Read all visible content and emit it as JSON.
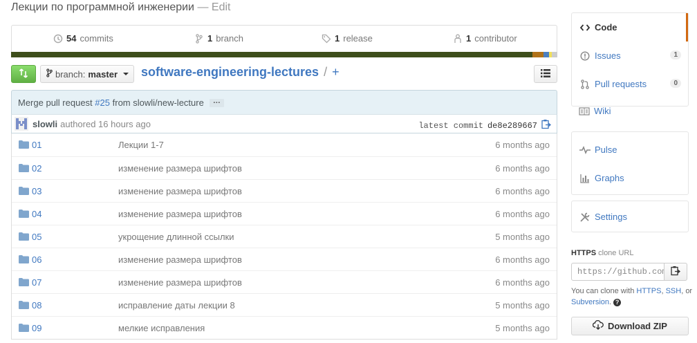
{
  "repo": {
    "description": "Лекции по программной инженерии",
    "edit_sep": "— ",
    "edit_label": "Edit",
    "name": "software-engineering-lectures",
    "path_sep": "/",
    "new_file": "+"
  },
  "summary": {
    "commits_count": "54",
    "commits_label": "commits",
    "branches_count": "1",
    "branches_label": "branch",
    "releases_count": "1",
    "releases_label": "release",
    "contributors_count": "1",
    "contributors_label": "contributor"
  },
  "language_bar": [
    {
      "share": 0.955,
      "color": "#3e4e1b"
    },
    {
      "share": 0.02,
      "color": "#b07219"
    },
    {
      "share": 0.01,
      "color": "#4c7fbf"
    },
    {
      "share": 0.005,
      "color": "#f1e05a"
    },
    {
      "share": 0.01,
      "color": "#ccc"
    }
  ],
  "toolbar": {
    "branch_prefix": "branch:",
    "branch_name": "master"
  },
  "commit": {
    "message_prefix": "Merge pull request",
    "pr_number": "#25",
    "message_suffix": "from slowli/new-lecture",
    "ellipsis": "…",
    "author": "slowli",
    "authored_text": "authored 16 hours ago",
    "latest_label": "latest commit",
    "sha": "de8e289667"
  },
  "files": [
    {
      "name": "01",
      "message": "Лекции 1-7",
      "age": "6 months ago"
    },
    {
      "name": "02",
      "message": "изменение размера шрифтов",
      "age": "6 months ago"
    },
    {
      "name": "03",
      "message": "изменение размера шрифтов",
      "age": "6 months ago"
    },
    {
      "name": "04",
      "message": "изменение размера шрифтов",
      "age": "6 months ago"
    },
    {
      "name": "05",
      "message": "укрощение длинной ссылки",
      "age": "5 months ago"
    },
    {
      "name": "06",
      "message": "изменение размера шрифтов",
      "age": "6 months ago"
    },
    {
      "name": "07",
      "message": "изменение размера шрифтов",
      "age": "6 months ago"
    },
    {
      "name": "08",
      "message": "исправление даты лекции 8",
      "age": "5 months ago"
    },
    {
      "name": "09",
      "message": "мелкие исправления",
      "age": "5 months ago"
    }
  ],
  "sidebar": {
    "code": "Code",
    "issues": "Issues",
    "issues_count": "1",
    "pulls": "Pull requests",
    "pulls_count": "0",
    "wiki": "Wiki",
    "pulse": "Pulse",
    "graphs": "Graphs",
    "settings": "Settings"
  },
  "clone": {
    "protocol": "HTTPS",
    "title_suffix": "clone URL",
    "url": "https://github.com/slowli/software-engineering-lectures.git",
    "help_prefix": "You can clone with",
    "https": "HTTPS",
    "comma": ",",
    "ssh": "SSH",
    "or": ", or",
    "subversion": "Subversion",
    "period": ".",
    "help_icon": "?",
    "download_label": "Download ZIP"
  },
  "colors": {
    "accent_green": "#60b044",
    "link_blue": "#4078c0",
    "selected_nav": "#d26911"
  }
}
